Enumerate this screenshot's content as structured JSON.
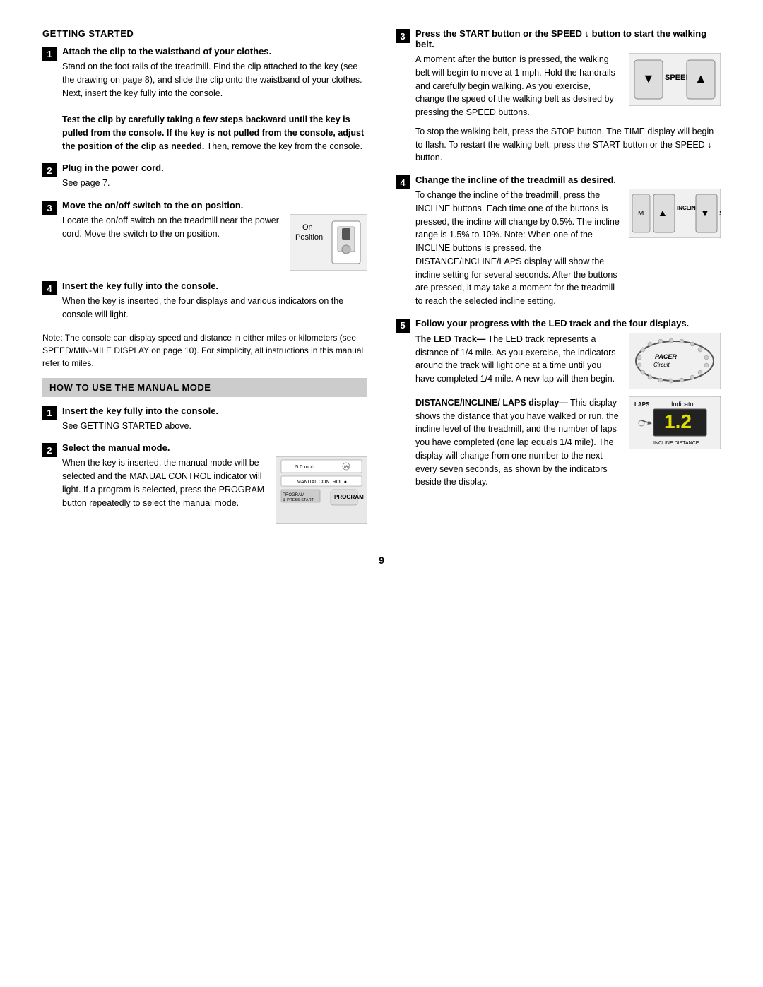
{
  "page": {
    "number": "9",
    "left_column": {
      "getting_started_header": "GETTING STARTED",
      "step1_title": "Attach the clip to the waistband of your clothes.",
      "step1_body": "Stand on the foot rails of the treadmill. Find the clip attached to the key (see the drawing on page 8), and slide the clip onto the waistband of your clothes. Next, insert the key fully into the console.",
      "step1_bold": "Test the clip by carefully taking a few steps backward until the key is pulled from the console. If the key is not pulled from the console, adjust the position of the clip as needed.",
      "step1_after_bold": " Then, remove the key from the console.",
      "step2_title": "Plug in the power cord.",
      "step2_body": "See page 7.",
      "step3_title": "Move the on/off switch to the on position.",
      "step3_body": "Locate the on/off switch on the treadmill near the power cord. Move the switch to the on position.",
      "on_position_label": "On\nPosition",
      "step4_title": "Insert the key fully into the console.",
      "step4_body": "When the key is inserted, the four displays and various indicators on the console will light.",
      "note_body": "Note: The console can display speed and distance in either miles or kilometers (see SPEED/MIN-MILE DISPLAY on page 10). For simplicity, all instructions in this manual refer to miles.",
      "how_to_manual_header": "HOW TO USE THE MANUAL MODE",
      "manual_step1_title": "Insert the key fully into the console.",
      "manual_step1_body": "See GETTING STARTED above.",
      "manual_step2_title": "Select the manual mode.",
      "manual_step2_body1": "When the key is inserted, the manual mode will be selected and the MANUAL CONTROL indicator will light. If a program is selected, press the PROGRAM button repeatedly to select the manual mode.",
      "manual_control_label": "MANUAL CONTROL",
      "program_label": "PROGRAM",
      "press_start_label": "PRESS START"
    },
    "right_column": {
      "step3_title": "Press the START button or the SPEED ↓ button to start the walking belt.",
      "step3_body1": "A moment after the button is pressed, the walking belt will begin to move at 1 mph. Hold the handrails and carefully begin walking. As you exercise, change the speed of the walking belt as desired by pressing the SPEED buttons.",
      "speed_label": "SPEED",
      "stop_restart_body": "To stop the walking belt, press the STOP button. The TIME display will begin to flash. To restart the walking belt, press the START button or the SPEED ↓ button.",
      "step4_title": "Change the incline of the treadmill as desired.",
      "step4_body": "To change the incline of the treadmill, press the INCLINE buttons. Each time one of the buttons is pressed, the incline will change by 0.5%. The incline range is 1.5% to 10%. Note: When one of the INCLINE buttons is pressed, the DISTANCE/INCLINE/LAPS display will show the incline setting for several seconds. After the buttons are pressed, it may take a moment for the treadmill to reach the selected incline setting.",
      "incline_label": "INCLINE",
      "step5_title": "Follow your progress with the LED track and the four displays.",
      "led_track_title": "The LED Track",
      "led_track_body": "The LED track represents a distance of 1/4 mile. As you exercise, the indicators around the track will light one at a time until you have completed 1/4 mile. A new lap will then begin.",
      "pacer_circuit_label": "PACER Circuit",
      "dist_incline_laps_title": "DISTANCE/INCLINE/ LAPS display",
      "dist_incline_laps_body": "This display shows the distance that you have walked or run, the incline level of the treadmill, and the number of laps you have completed (one lap equals 1/4 mile). The display will change from one number to the next every seven seconds, as shown by the indicators beside the display.",
      "laps_label": "LAPS",
      "indicator_label": "Indicator",
      "incline_distance_label": "INCLINE   DISTANCE",
      "display_value": "1.2"
    }
  }
}
